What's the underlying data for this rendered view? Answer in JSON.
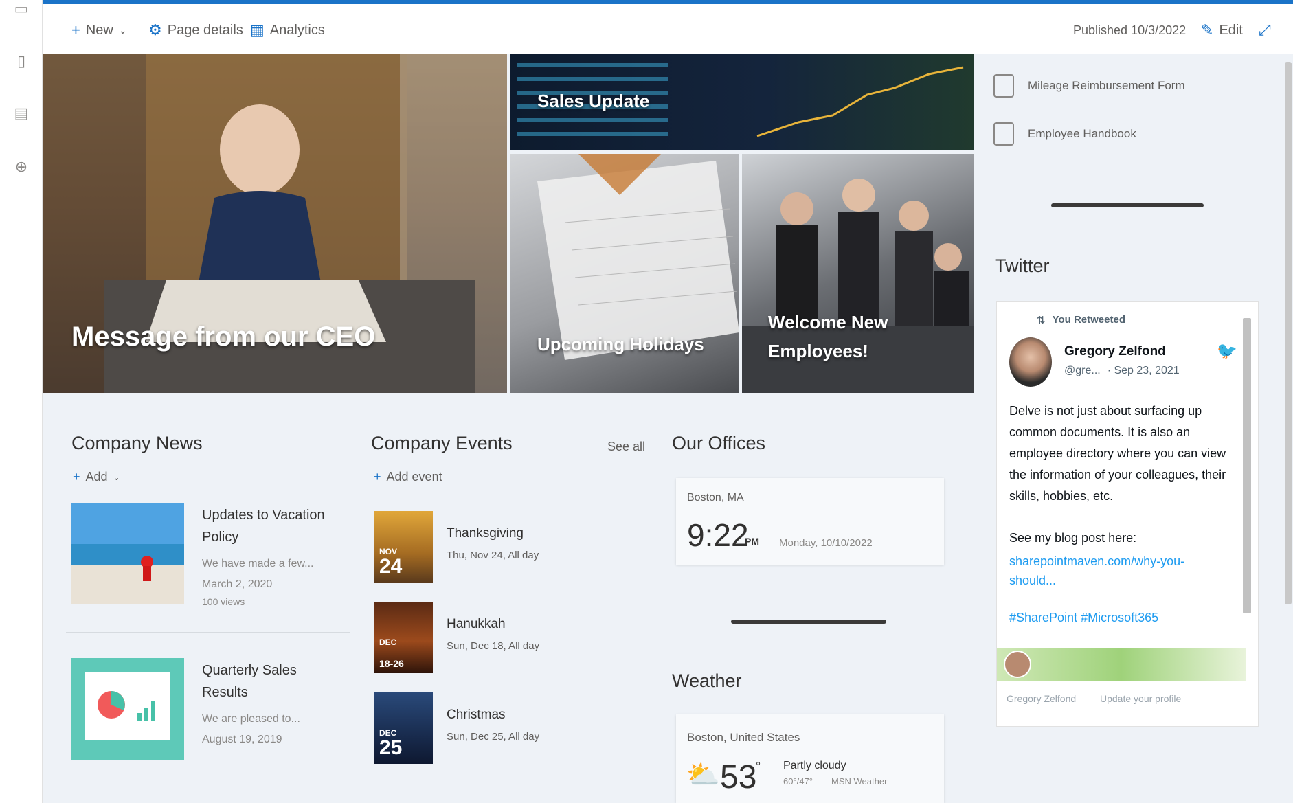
{
  "commandbar": {
    "new_label": "New",
    "page_details_label": "Page details",
    "analytics_label": "Analytics",
    "published": "Published 10/3/2022",
    "edit_label": "Edit"
  },
  "hero": {
    "ceo": "Message from our CEO",
    "sales": "Sales Update",
    "holidays": "Upcoming Holidays",
    "employees": "Welcome New Employees!"
  },
  "news": {
    "title": "Company News",
    "add_label": "Add",
    "items": [
      {
        "title": "Updates to Vacation Policy",
        "snippet": "We have made a few...",
        "date": "March 2, 2020",
        "views": "100 views"
      },
      {
        "title": "Quarterly Sales Results",
        "snippet": "We are pleased to...",
        "date": "August 19, 2019"
      }
    ]
  },
  "events": {
    "title": "Company Events",
    "see_all": "See all",
    "add_label": "Add event",
    "items": [
      {
        "month": "NOV",
        "day": "24",
        "name": "Thanksgiving",
        "when": "Thu, Nov 24, All day"
      },
      {
        "month": "DEC",
        "day": "18-26",
        "name": "Hanukkah",
        "when": "Sun, Dec 18, All day"
      },
      {
        "month": "DEC",
        "day": "25",
        "name": "Christmas",
        "when": "Sun, Dec 25, All day"
      }
    ]
  },
  "offices": {
    "title": "Our Offices",
    "city": "Boston, MA",
    "time": "9:22",
    "ampm": "PM",
    "date": "Monday, 10/10/2022"
  },
  "weather": {
    "title": "Weather",
    "location": "Boston, United States",
    "temp": "53",
    "unit": "°",
    "condition": "Partly cloudy",
    "range": "60°/47°",
    "source": "MSN Weather"
  },
  "quicklinks": [
    {
      "label": "Mileage Reimbursement Form"
    },
    {
      "label": "Employee Handbook"
    }
  ],
  "twitter": {
    "title": "Twitter",
    "retweeted": "You Retweeted",
    "author": "Gregory Zelfond",
    "handle": "@gre...",
    "date": "· Sep 23, 2021",
    "body": "Delve is not just about surfacing up common documents. It is also an employee directory where you can view the information of your colleagues, their skills, hobbies, etc.",
    "blog_line": "See my blog post here:",
    "link": "sharepointmaven.com/why-you-should...",
    "hashtags": "#SharePoint #Microsoft365",
    "profile_name": "Gregory Zelfond",
    "profile_action": "Update your profile"
  }
}
